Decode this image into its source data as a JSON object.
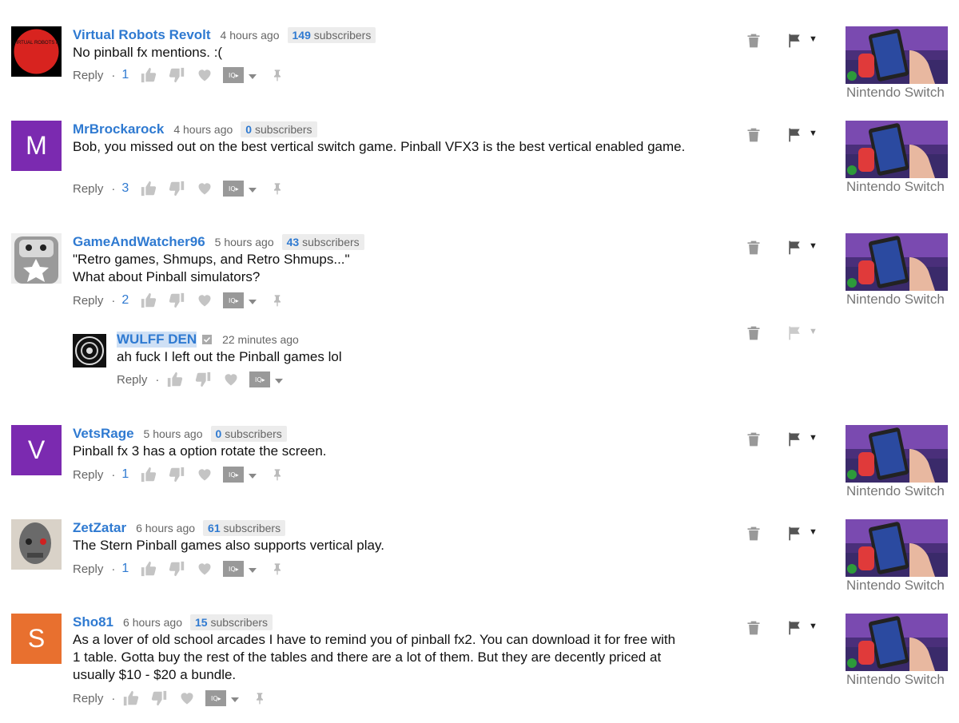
{
  "common": {
    "reply_label": "Reply",
    "dot": "·",
    "iq_badge": "IQ▸",
    "flag_caret": "▼"
  },
  "colors": {
    "author": "#2f7ad1",
    "subtext": "#666666",
    "badge_bg": "#ececec"
  },
  "comments": [
    {
      "author": "Virtual Robots Revolt",
      "time": "4 hours ago",
      "subs_count": "149",
      "subs_label": "subscribers",
      "text": "No pinball fx mentions. :(",
      "likes": "1",
      "avatar_text": "V.R.R.\nVIRTUAL ROBOTS\nREVOLT",
      "thumb_caption": "Nintendo Switch"
    },
    {
      "author": "MrBrockarock",
      "time": "4 hours ago",
      "subs_count": "0",
      "subs_label": "subscribers",
      "text": "Bob, you missed out on the best vertical switch game. Pinball VFX3 is the best vertical enabled game.",
      "likes": "3",
      "avatar_letter": "M",
      "avatar_color": "#7b2ab0",
      "thumb_caption": "Nintendo Switch"
    },
    {
      "author": "GameAndWatcher96",
      "time": "5 hours ago",
      "subs_count": "43",
      "subs_label": "subscribers",
      "text": "\"Retro games, Shmups, and Retro Shmups...\"\nWhat about Pinball simulators?",
      "likes": "2",
      "thumb_caption": "Nintendo Switch"
    },
    {
      "author": "WULFF DEN",
      "time": "22 minutes ago",
      "text": "ah fuck I left out the Pinball games lol",
      "verified_icon": "check-badge-icon"
    },
    {
      "author": "VetsRage",
      "time": "5 hours ago",
      "subs_count": "0",
      "subs_label": "subscribers",
      "text": "Pinball fx 3 has a option rotate the screen.",
      "likes": "1",
      "avatar_letter": "V",
      "avatar_color": "#7b2ab0",
      "thumb_caption": "Nintendo Switch"
    },
    {
      "author": "ZetZatar",
      "time": "6 hours ago",
      "subs_count": "61",
      "subs_label": "subscribers",
      "text": "The Stern Pinball games also supports vertical play.",
      "likes": "1",
      "thumb_caption": "Nintendo Switch"
    },
    {
      "author": "Sho81",
      "time": "6 hours ago",
      "subs_count": "15",
      "subs_label": "subscribers",
      "text": "As a lover of old school arcades I have to remind you of pinball fx2. You can download it for free with\n1 table. Gotta buy the rest of the tables and there are a lot of them.  But they are decently priced at\nusually $10 - $20 a bundle.",
      "avatar_letter": "S",
      "avatar_color": "#e8702f",
      "thumb_caption": "Nintendo Switch"
    }
  ]
}
